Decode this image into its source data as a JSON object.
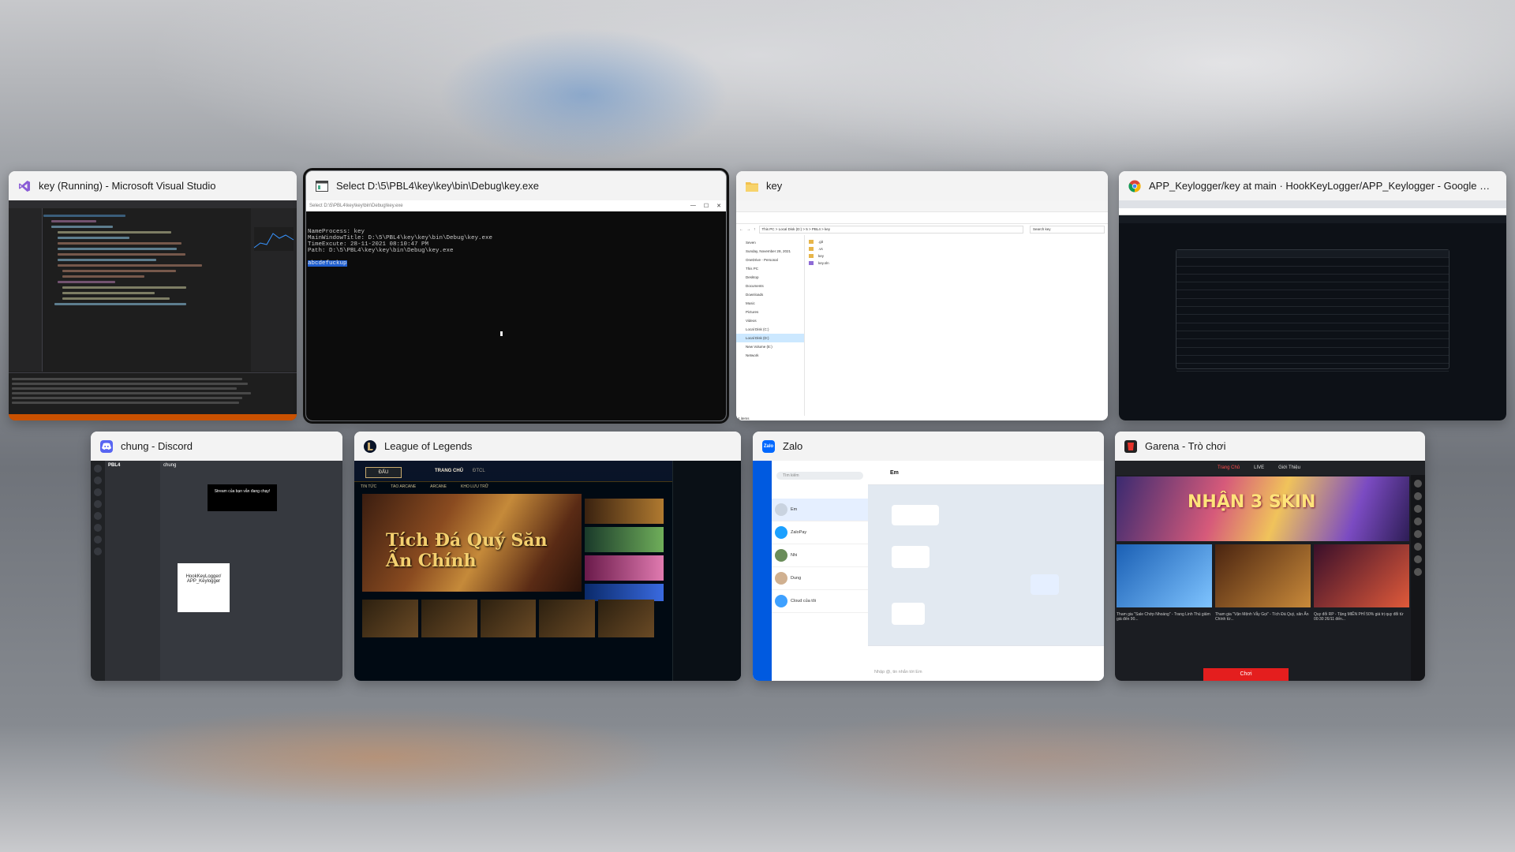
{
  "windows": [
    {
      "title": "key (Running) - Microsoft Visual Studio",
      "icon": "visual-studio-icon",
      "accent": "#8a5cd6"
    },
    {
      "title": "Select D:\\5\\PBL4\\key\\key\\bin\\Debug\\key.exe",
      "icon": "console-icon",
      "selected": true,
      "inner_title": "Select D:\\5\\PBL4\\key\\key\\bin\\Debug\\key.exe",
      "lines": [
        "NameProcess: key",
        "MainWindowTitle: D:\\5\\PBL4\\key\\key\\bin\\Debug\\key.exe",
        "TimeExcute: 28-11-2021 08:10:47 PM",
        "Path: D:\\5\\PBL4\\key\\key\\bin\\Debug\\key.exe"
      ],
      "typed": "abcdefuckup"
    },
    {
      "title": "key",
      "icon": "folder-icon",
      "address": "This PC  >  Local Disk (D:)  >  5  >  PBL4  >  key",
      "search_placeholder": "Search key",
      "nav": [
        "Seven",
        "Sunday, November 28, 2021",
        "OneDrive - Personal",
        "This PC",
        "Desktop",
        "Documents",
        "Downloads",
        "Music",
        "Pictures",
        "Videos",
        "Local Disk (C:)",
        "Local Disk (D:)",
        "New Volume (E:)",
        "Network"
      ],
      "files": [
        ".git",
        ".vs",
        "key",
        "key.sln"
      ],
      "status": "4 items"
    },
    {
      "title": "APP_Keylogger/key at main · HookKeyLogger/APP_Keylogger - Google Chr...",
      "icon": "chrome-icon"
    },
    {
      "title": "chung - Discord",
      "icon": "discord-icon",
      "server": "PBL4",
      "channel": "chung",
      "overlay_text": "Stream của bạn vẫn đang chạy!",
      "embed_title": "HookKeyLogger/ APP_Keylogger"
    },
    {
      "title": "League of Legends",
      "icon": "league-icon",
      "play_label": "ĐẤU",
      "tab_home": "TRANG CHỦ",
      "tab_tft": "ĐTCL",
      "banner_text": "Tích Đá Quý Săn Ấn Chính",
      "subtabs": [
        "TIN TỨC",
        "TAO ARCANE",
        "ARCANE",
        "KHO LƯU TRỮ"
      ]
    },
    {
      "title": "Zalo",
      "icon": "zalo-icon",
      "search_placeholder": "Tìm kiếm",
      "contact": "Em",
      "contacts": [
        "Em",
        "ZaloPay",
        "Nhi",
        "Dung",
        "Cloud của tôi"
      ],
      "composer_placeholder": "Nhập @, tin nhắn tới Em"
    },
    {
      "title": "Garena - Trò chơi",
      "icon": "garena-icon",
      "tabs": [
        "Trang Chủ",
        "LIVE",
        "Giới Thiệu"
      ],
      "hero_text": "NHẬN 3 SKIN",
      "cards": [
        "Tham gia \"Sale Chớp Nhoáng\" - Trang Linh Thú giảm giá đến 90...",
        "Tham gia \"Vận Mệnh Vẫy Gọi\" - Tích Đá Quý, săn Ấn Chính từ...",
        "Quy đổi RP - Tặng MIỄN PHÍ 50% giá trị quy đổi từ 00:30 26/11 đến..."
      ],
      "play_label": "Chơi"
    }
  ]
}
